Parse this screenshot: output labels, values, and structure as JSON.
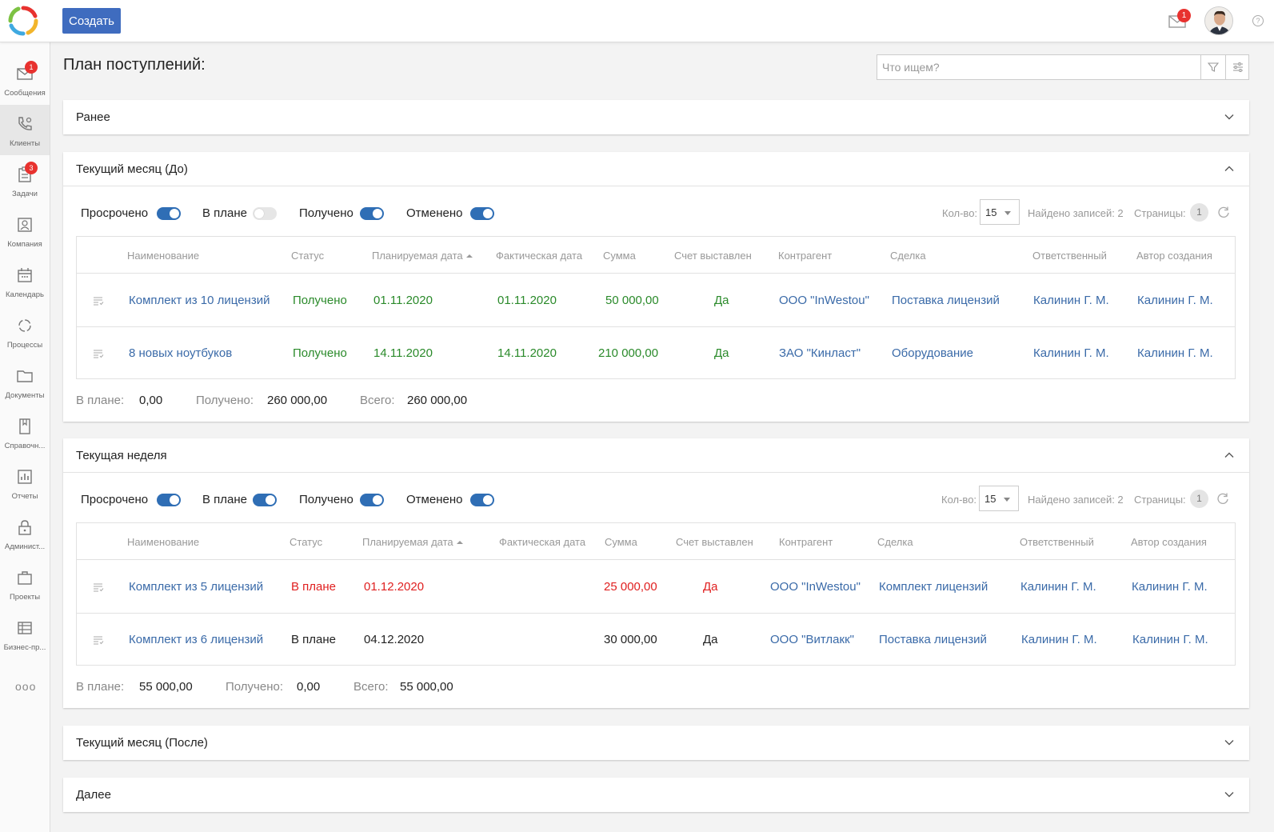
{
  "header": {
    "create_label": "Создать",
    "mail_badge": "1",
    "help": "?"
  },
  "sidebar": {
    "items": [
      {
        "label": "Сообщения",
        "icon": "mail-icon",
        "badge": "1"
      },
      {
        "label": "Клиенты",
        "icon": "phone-icon"
      },
      {
        "label": "Задачи",
        "icon": "clipboard-icon",
        "badge": "3"
      },
      {
        "label": "Компания",
        "icon": "contact-card-icon"
      },
      {
        "label": "Календарь",
        "icon": "calendar-icon"
      },
      {
        "label": "Процессы",
        "icon": "cycle-icon"
      },
      {
        "label": "Документы",
        "icon": "folder-icon"
      },
      {
        "label": "Справочн...",
        "icon": "book-icon"
      },
      {
        "label": "Отчеты",
        "icon": "chart-icon"
      },
      {
        "label": "Админист...",
        "icon": "lock-icon"
      },
      {
        "label": "Проекты",
        "icon": "briefcase-icon"
      },
      {
        "label": "Бизнес-пр...",
        "icon": "table-icon"
      }
    ],
    "more": "ooo"
  },
  "page": {
    "title": "План поступлений:",
    "search_placeholder": "Что ищем?"
  },
  "common": {
    "filters": [
      "Просрочено",
      "В плане",
      "Получено",
      "Отменено"
    ],
    "kol_label": "Кол-во:",
    "kol_value": "15",
    "found_label": "Найдено записей: 2",
    "pages_label": "Страницы:",
    "page_num": "1",
    "columns": [
      "Наименование",
      "Статус",
      "Планируемая дата",
      "Фактическая дата",
      "Сумма",
      "Счет выставлен",
      "Контрагент",
      "Сделка",
      "Ответственный",
      "Автор создания"
    ],
    "totals_labels": [
      "В плане:",
      "Получено:",
      "Всего:"
    ]
  },
  "sections": [
    {
      "title": "Ранее",
      "open": false
    },
    {
      "title": "Текущий месяц (До)",
      "open": true,
      "toggles": [
        true,
        false,
        true,
        true
      ],
      "rows": [
        {
          "name": "Комплект из 10 лицензий",
          "status": "Получено",
          "planned": "01.11.2020",
          "actual": "01.11.2020",
          "sum": "50 000,00",
          "invoiced": "Да",
          "counterparty": "ООО \"InWestou\"",
          "deal": "Поставка лицензий",
          "responsible": "Калинин Г. М.",
          "author": "Калинин Г. М."
        },
        {
          "name": "8 новых ноутбуков",
          "status": "Получено",
          "planned": "14.11.2020",
          "actual": "14.11.2020",
          "sum": "210 000,00",
          "invoiced": "Да",
          "counterparty": "ЗАО \"Кинласт\"",
          "deal": "Оборудование",
          "responsible": "Калинин Г. М.",
          "author": "Калинин Г. М."
        }
      ],
      "totals": [
        "0,00",
        "260 000,00",
        "260 000,00"
      ]
    },
    {
      "title": "Текущая неделя",
      "open": true,
      "toggles": [
        true,
        true,
        true,
        true
      ],
      "rows": [
        {
          "name": "Комплект из 5 лицензий",
          "status": "В плане",
          "planned": "01.12.2020",
          "actual": "",
          "sum": "25 000,00",
          "invoiced": "Да",
          "counterparty": "ООО \"InWestou\"",
          "deal": "Комплект лицензий",
          "responsible": "Калинин Г. М.",
          "author": "Калинин Г. М."
        },
        {
          "name": "Комплект из 6 лицензий",
          "status": "В плане",
          "planned": "04.12.2020",
          "actual": "",
          "sum": "30 000,00",
          "invoiced": "Да",
          "counterparty": "ООО \"Витлакк\"",
          "deal": "Поставка лицензий",
          "responsible": "Калинин Г. М.",
          "author": "Калинин Г. М."
        }
      ],
      "totals": [
        "55 000,00",
        "0,00",
        "55 000,00"
      ]
    },
    {
      "title": "Текущий месяц (После)",
      "open": false
    },
    {
      "title": "Далее",
      "open": false
    }
  ],
  "colors": {
    "accent": "#3f6cbf",
    "toggle_on": "#2f6eb5",
    "link": "#3a6aa8",
    "success": "#2a8a2a",
    "overdue": "#e02020",
    "badge": "#e8322f"
  }
}
